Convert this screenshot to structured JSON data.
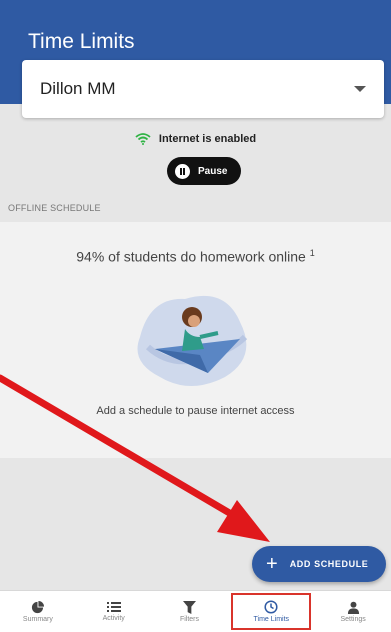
{
  "header": {
    "title": "Time Limits"
  },
  "profile_select": {
    "selected": "Dillon MM"
  },
  "status": {
    "text": "Internet is enabled"
  },
  "pause_button": {
    "label": "Pause"
  },
  "section": {
    "label": "OFFLINE SCHEDULE"
  },
  "card": {
    "title": "94% of students do homework online",
    "footnote": "1",
    "description": "Add a schedule to pause internet access"
  },
  "fab": {
    "label": "ADD SCHEDULE"
  },
  "bottom_nav": {
    "items": [
      {
        "label": "Summary",
        "icon": "pie-chart-icon"
      },
      {
        "label": "Activity",
        "icon": "list-icon"
      },
      {
        "label": "Filters",
        "icon": "filter-icon"
      },
      {
        "label": "Time Limits",
        "icon": "clock-icon"
      },
      {
        "label": "Settings",
        "icon": "person-icon"
      }
    ],
    "active": "Time Limits"
  },
  "colors": {
    "primary": "#2f5aa3",
    "annotation_red": "#e0181b",
    "wifi_green": "#2fb344"
  }
}
